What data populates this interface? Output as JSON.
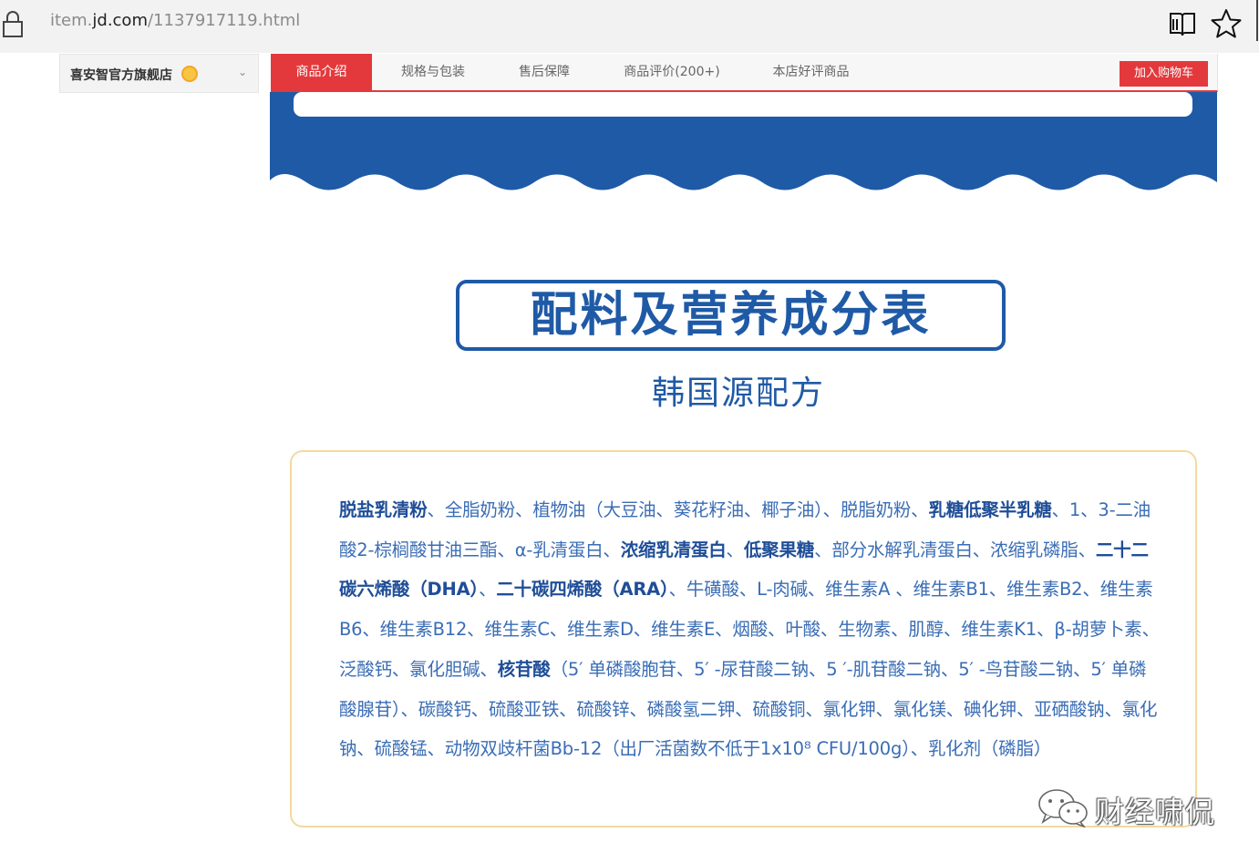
{
  "browser": {
    "url_prefix": "item.",
    "url_domain": "jd.com",
    "url_path": "/1137917119.html"
  },
  "store": {
    "name": "喜安智官方旗舰店",
    "caret": "⌄"
  },
  "tabs": [
    {
      "label": "商品介绍",
      "active": true
    },
    {
      "label": "规格与包装",
      "active": false
    },
    {
      "label": "售后保障",
      "active": false
    },
    {
      "label": "商品评价(200+)",
      "active": false
    },
    {
      "label": "本店好评商品",
      "active": false
    }
  ],
  "add_to_cart": "加入购物车",
  "content": {
    "title": "配料及营养成分表",
    "subtitle": "韩国源配方",
    "ingredients": [
      {
        "t": "脱盐乳清粉",
        "b": true
      },
      {
        "t": "、全脂奶粉、植物油（大豆油、葵花籽油、椰子油）、脱脂奶粉、",
        "b": false
      },
      {
        "t": "乳糖低聚半乳糖",
        "b": true
      },
      {
        "t": "、1、3-二油酸2-棕榈酸甘油三酯、α-乳清蛋白、",
        "b": false
      },
      {
        "t": "浓缩乳清蛋白",
        "b": true
      },
      {
        "t": "、",
        "b": false
      },
      {
        "t": "低聚果糖",
        "b": true
      },
      {
        "t": "、部分水解乳清蛋白、浓缩乳磷脂、",
        "b": false
      },
      {
        "t": "二十二碳六烯酸（DHA）",
        "b": true
      },
      {
        "t": "、",
        "b": false
      },
      {
        "t": "二十碳四烯酸（ARA）",
        "b": true
      },
      {
        "t": "、牛磺酸、L-肉碱、维生素A 、维生素B1、维生素B2、维生素B6、维生素B12、维生素C、维生素D、维生素E、烟酸、叶酸、生物素、肌醇、维生素K1、β-胡萝卜素、泛酸钙、氯化胆碱、",
        "b": false
      },
      {
        "t": "核苷酸",
        "b": true
      },
      {
        "t": "（5′ 单磷酸胞苷、5′ -尿苷酸二钠、5 ′-肌苷酸二钠、5′ -鸟苷酸二钠、5′ 单磷酸腺苷）、碳酸钙、硫酸亚铁、硫酸锌、磷酸氢二钾、硫酸铜、氯化钾、氯化镁、碘化钾、亚硒酸钠、氯化钠、硫酸锰、动物双歧杆菌Bb-12（出厂活菌数不低于1x10⁸ CFU/100g）、乳化剂（磷脂）",
        "b": false
      }
    ]
  },
  "watermark": {
    "text": "财经啸侃"
  },
  "colors": {
    "brand_red": "#e4393c",
    "brand_blue": "#1f5aa6",
    "card_border": "#f3d9a0"
  }
}
